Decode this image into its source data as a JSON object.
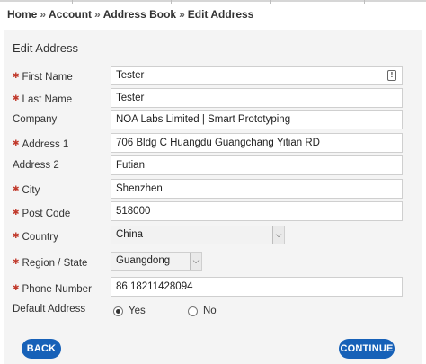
{
  "breadcrumb": {
    "items": [
      "Home",
      "Account",
      "Address Book"
    ],
    "current": "Edit Address",
    "separator": "»"
  },
  "title": "Edit Address",
  "required_marker": "✱",
  "fields": {
    "first_name": {
      "label": "First Name",
      "value": "Tester",
      "required": true
    },
    "last_name": {
      "label": "Last Name",
      "value": "Tester",
      "required": true
    },
    "company": {
      "label": "Company",
      "value": "NOA Labs Limited | Smart Prototyping",
      "required": false
    },
    "address1": {
      "label": "Address 1",
      "value": "706 Bldg C Huangdu Guangchang Yitian RD",
      "required": true
    },
    "address2": {
      "label": "Address 2",
      "value": "Futian",
      "required": false
    },
    "city": {
      "label": "City",
      "value": "Shenzhen",
      "required": true
    },
    "post_code": {
      "label": "Post Code",
      "value": "518000",
      "required": true
    },
    "country": {
      "label": "Country",
      "value": "China",
      "required": true
    },
    "region": {
      "label": "Region / State",
      "value": "Guangdong",
      "required": true
    },
    "phone": {
      "label": "Phone Number",
      "value": "86 18211428094",
      "required": true
    }
  },
  "default_address": {
    "label": "Default Address",
    "options": [
      "Yes",
      "No"
    ],
    "selected": "Yes"
  },
  "buttons": {
    "back": "BACK",
    "continue": "CONTINUE"
  },
  "colors": {
    "button": "#1761b8",
    "required": "#c0392b",
    "panel": "#f4f4f4"
  }
}
